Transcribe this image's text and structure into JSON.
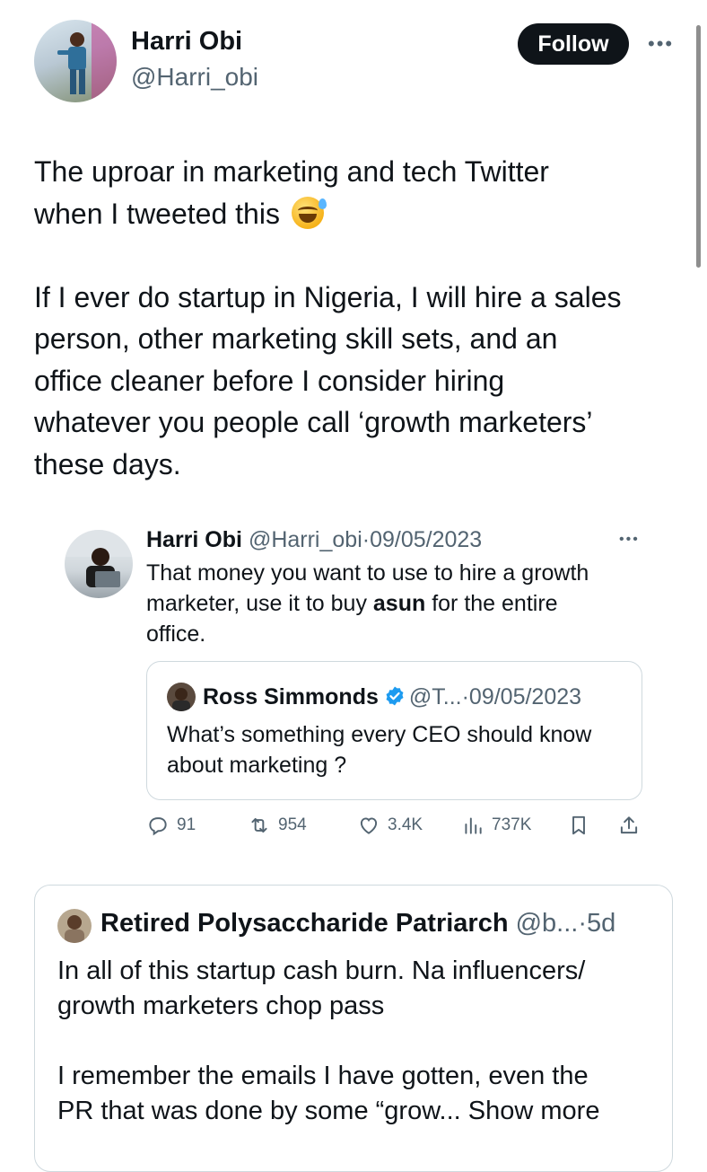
{
  "author": {
    "name": "Harri Obi",
    "handle": "@Harri_obi",
    "follow_label": "Follow"
  },
  "tweet": {
    "line1": "The uproar in marketing and tech Twitter",
    "line2": "when I tweeted this",
    "emoji": "grinning-sweat-emoji",
    "line3": "If I ever do startup in Nigeria, I will hire a sales",
    "line4": "person, other marketing skill sets, and an",
    "line5": "office cleaner before I consider hiring",
    "line6": "whatever you people call ‘growth marketers’",
    "line7": "these days."
  },
  "quoted": {
    "name": "Harri Obi",
    "handle": "@Harri_obi",
    "sep": "·",
    "date": "09/05/2023",
    "text_before_bold": "That money you want to use to hire a growth",
    "text_line2_a": "marketer, use it to buy ",
    "text_bold": "asun",
    "text_line2_b": " for the entire",
    "text_line3": "office."
  },
  "inner_quote": {
    "name": "Ross Simmonds",
    "handle": "@T...",
    "sep": "·",
    "date": "09/05/2023",
    "line1": "What’s something every CEO should know",
    "line2": "about marketing ?"
  },
  "actions": {
    "replies": "91",
    "retweets": "954",
    "likes": "3.4K",
    "views": "737K"
  },
  "reply": {
    "name": "Retired Polysaccharide Patriarch",
    "handle": "@b...",
    "sep": "·",
    "time": "5d",
    "line1": "In all of this startup cash burn. Na influencers/",
    "line2": "growth marketers chop pass",
    "line3": "I remember the emails I have gotten, even the",
    "line4": "PR that was done by some “grow...",
    "show_more": "Show more"
  },
  "colors": {
    "text": "#0f1419",
    "muted": "#536471",
    "border": "#cfd9de",
    "verified": "#1d9bf0",
    "follow_bg": "#0f1419"
  }
}
